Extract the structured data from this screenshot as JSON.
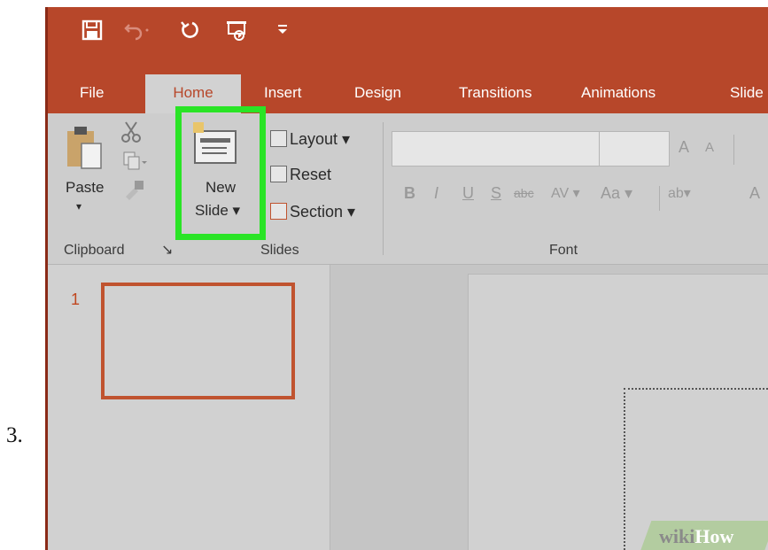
{
  "step": {
    "number": "3."
  },
  "qat": {
    "items": [
      {
        "name": "save-icon",
        "glyph": "🖫"
      },
      {
        "name": "undo-icon",
        "glyph": "↶·"
      },
      {
        "name": "redo-icon",
        "glyph": "↻"
      },
      {
        "name": "start-from-beginning-icon",
        "glyph": "⎚"
      },
      {
        "name": "customize-qat-icon",
        "glyph": "⏷"
      }
    ]
  },
  "tabs": [
    "File",
    "Home",
    "Insert",
    "Design",
    "Transitions",
    "Animations",
    "Slide"
  ],
  "active_tab": "Home",
  "ribbon": {
    "clipboard": {
      "paste_label": "Paste",
      "paste_arrow": "▾",
      "group_label": "Clipboard",
      "launcher": "↘"
    },
    "slides": {
      "new_slide_line1": "New",
      "new_slide_line2": "Slide ▾",
      "layout_label": "Layout ▾",
      "reset_label": "Reset",
      "section_label": "Section ▾",
      "group_label": "Slides"
    },
    "font": {
      "group_label": "Font",
      "buttons": [
        "B",
        "I",
        "U",
        "S",
        "abc",
        "AV ▾",
        "Aa ▾",
        "ab▾",
        "A"
      ],
      "grow": "A",
      "shrink": "A"
    }
  },
  "slides_pane": {
    "thumbnails": [
      {
        "number": "1"
      }
    ]
  },
  "watermark": {
    "part1": "wiki",
    "part2": "How"
  },
  "colors": {
    "accent": "#b7472a",
    "highlight": "#2ae426",
    "slide_border": "#c0532f"
  }
}
